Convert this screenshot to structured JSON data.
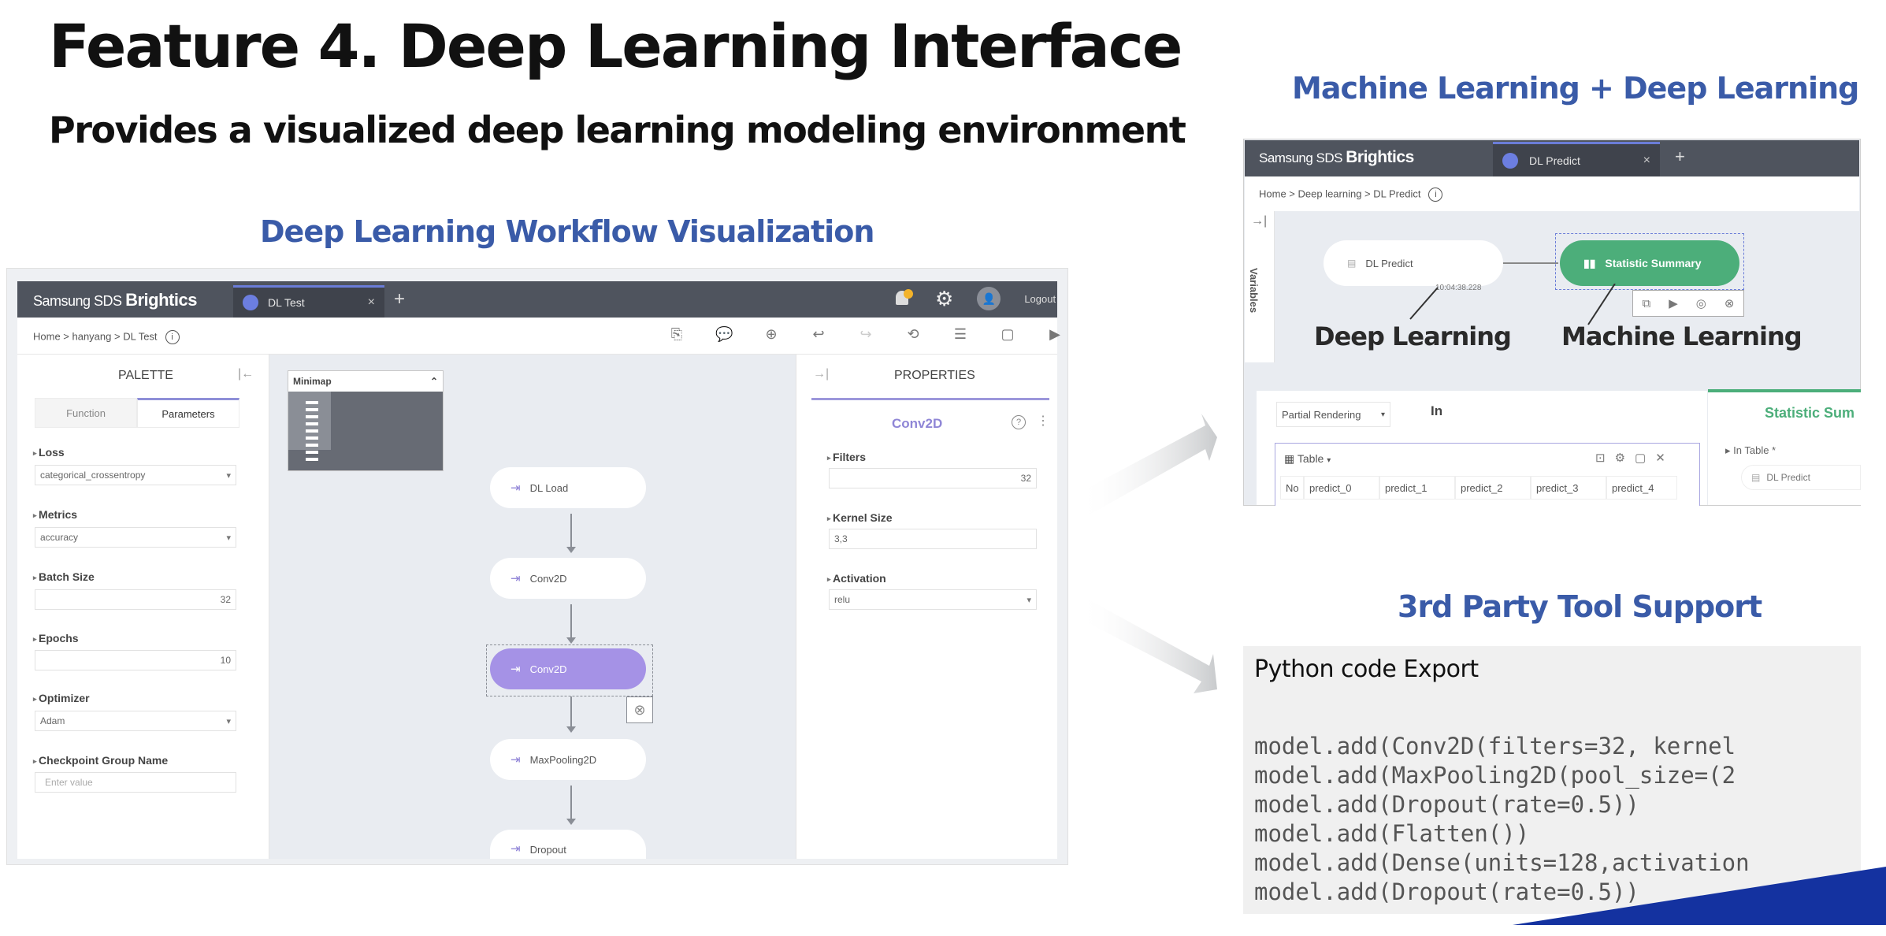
{
  "slide": {
    "title": "Feature 4. Deep Learning Interface",
    "subtitle": "Provides a visualized deep learning modeling environment",
    "section_left": "Deep Learning Workflow Visualization",
    "section_right_top": "Machine Learning + Deep Learning",
    "section_right_bottom": "3rd Party Tool Support",
    "accent_color": "#3a5ba8"
  },
  "left_app": {
    "brand_small": "Samsung SDS",
    "brand_big": "Brightics",
    "tab_label": "DL Test",
    "tab_close": "×",
    "tab_add": "+",
    "logout": "Logout",
    "breadcrumb": "Home > hanyang > DL Test",
    "toolbar_icons": [
      "code-export-icon",
      "comment-icon",
      "zoom-in-icon",
      "undo-icon",
      "redo-icon",
      "history-icon",
      "document-icon",
      "note-icon",
      "run-icon"
    ],
    "palette": {
      "title": "PALETTE",
      "tabs": [
        "Function",
        "Parameters"
      ],
      "active_tab": "Parameters",
      "fields": [
        {
          "label": "Loss",
          "value": "categorical_crossentropy",
          "type": "select"
        },
        {
          "label": "Metrics",
          "value": "accuracy",
          "type": "select"
        },
        {
          "label": "Batch Size",
          "value": "32",
          "type": "number"
        },
        {
          "label": "Epochs",
          "value": "10",
          "type": "number"
        },
        {
          "label": "Optimizer",
          "value": "Adam",
          "type": "select"
        },
        {
          "label": "Checkpoint Group Name",
          "placeholder": "Enter value",
          "type": "text"
        }
      ]
    },
    "minimap": {
      "title": "Minimap"
    },
    "nodes": [
      {
        "label": "DL Load",
        "selected": false
      },
      {
        "label": "Conv2D",
        "selected": false
      },
      {
        "label": "Conv2D",
        "selected": true
      },
      {
        "label": "MaxPooling2D",
        "selected": false
      },
      {
        "label": "Dropout",
        "selected": false
      }
    ],
    "properties": {
      "title": "PROPERTIES",
      "function_name": "Conv2D",
      "fields": [
        {
          "label": "Filters",
          "value": "32",
          "type": "number"
        },
        {
          "label": "Kernel Size",
          "value": "3,3",
          "type": "text"
        },
        {
          "label": "Activation",
          "value": "relu",
          "type": "select"
        }
      ]
    }
  },
  "right_app": {
    "brand_small": "Samsung SDS",
    "brand_big": "Brightics",
    "tab_label": "DL Predict",
    "tab_close": "×",
    "tab_add": "+",
    "breadcrumb": "Home > Deep learning > DL Predict",
    "side_label": "Variables",
    "node_dl": "DL Predict",
    "node_ml": "Statistic Summary",
    "node_dl_time": "10:04:38.228",
    "annotation_dl": "Deep Learning",
    "annotation_ml": "Machine Learning",
    "partial_rendering": "Partial Rendering",
    "in_label": "In",
    "table_label": "Table",
    "table_columns": [
      "No",
      "predict_0",
      "predict_1",
      "predict_2",
      "predict_3",
      "predict_4"
    ],
    "stat_panel_title": "Statistic Sum",
    "in_table_label": "In Table",
    "in_table_value": "DL Predict",
    "ml_color": "#4cae7a"
  },
  "code_export": {
    "title": "Python code Export",
    "lines": [
      "model.add(Conv2D(filters=32, kernel",
      "model.add(MaxPooling2D(pool_size=(2",
      "model.add(Dropout(rate=0.5))",
      "model.add(Flatten())",
      "model.add(Dense(units=128,activation",
      "model.add(Dropout(rate=0.5))"
    ]
  }
}
